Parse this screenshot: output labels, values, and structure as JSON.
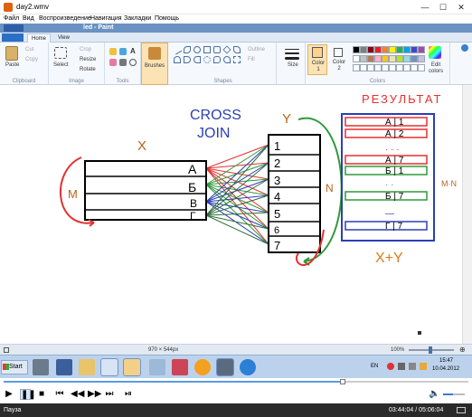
{
  "player": {
    "title": "day2.wmv",
    "menu": [
      "Файл",
      "Вид",
      "Воспроизведение",
      "Навигация",
      "Закладки",
      "Помощь"
    ],
    "status_text": "Пауза",
    "time": "03:44:04 / 05:06:04",
    "progress_fraction": 0.73,
    "volume_fraction": 0.45,
    "win_minimize": "—",
    "win_maximize": "☐",
    "win_close": "✕"
  },
  "paint": {
    "window_title": "led - Paint",
    "tabs": [
      "Home",
      "View"
    ],
    "clipboard": {
      "paste": "Paste",
      "cut": "Cut",
      "copy": "Copy",
      "group": "Clipboard"
    },
    "image": {
      "select": "Select",
      "crop": "Crop",
      "resize": "Resize",
      "rotate": "Rotate",
      "group": "Image"
    },
    "tools": {
      "group": "Tools",
      "text_tool": "A"
    },
    "brushes": "Brushes",
    "shapes": {
      "outline": "Outline",
      "fill": "Fill",
      "group": "Shapes"
    },
    "size": "Size",
    "color1": "Color 1",
    "color2": "Color 2",
    "colors_group": "Colors",
    "edit_colors": "Edit colors",
    "canvas_size": "970 × 544px",
    "zoom": "100%",
    "colors": {
      "color1": "#ffd48a",
      "palette_top": [
        "#000000",
        "#7f7f7f",
        "#880015",
        "#ed1c24",
        "#ff7f27",
        "#fff200",
        "#22b14c",
        "#00a2e8",
        "#3f48cc",
        "#a349a4"
      ],
      "palette_bottom": [
        "#ffffff",
        "#c3c3c3",
        "#b97a57",
        "#ffaec9",
        "#ffc90e",
        "#efe4b0",
        "#b5e61d",
        "#99d9ea",
        "#7092be",
        "#c8bfe7"
      ]
    }
  },
  "drawing": {
    "cross_join": [
      "CROSS",
      "JOIN"
    ],
    "x_label": "X",
    "y_label": "Y",
    "left_m": "M",
    "right_n": "N",
    "table_x": [
      "A",
      "Б",
      "В",
      "Г"
    ],
    "table_y": [
      "1",
      "2",
      "3",
      "4",
      "5",
      "6",
      "7"
    ],
    "result_title": "РЕЗУЛЬТАТ",
    "result_rows": [
      "А | 1",
      "А | 2",
      "· · ·",
      "А | 7",
      "Б | 1",
      "·   ·",
      "Б | 7",
      "—",
      "Г | 7"
    ],
    "mn": "M·N",
    "xy": "X+Y"
  },
  "taskbar": {
    "start": "Start",
    "lang": "EN",
    "time": "15:47",
    "date": "10.04.2012"
  }
}
